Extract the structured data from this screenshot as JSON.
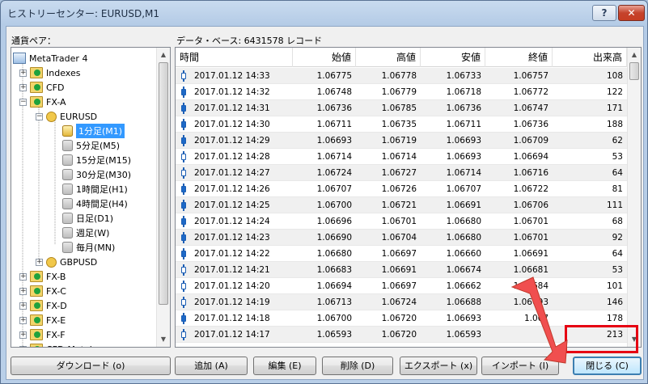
{
  "window": {
    "title": "ヒストリーセンター: EURUSD,M1"
  },
  "labels": {
    "pair": "通貨ペア：",
    "database": "データ・ベース: 6431578 レコード"
  },
  "tree": [
    {
      "label": "MetaTrader 4",
      "icon": "terminal-icon",
      "level": 0,
      "expander": ""
    },
    {
      "label": "Indexes",
      "icon": "folder-icon",
      "level": 1,
      "expander": "+"
    },
    {
      "label": "CFD",
      "icon": "folder-icon",
      "level": 1,
      "expander": "+"
    },
    {
      "label": "FX-A",
      "icon": "folder-icon",
      "level": 1,
      "expander": "−"
    },
    {
      "label": "EURUSD",
      "icon": "symbol-icon",
      "level": 2,
      "expander": "−"
    },
    {
      "label": "1分足(M1)",
      "icon": "database-active-icon",
      "level": 3,
      "expander": "",
      "selected": true
    },
    {
      "label": "5分足(M5)",
      "icon": "database-icon",
      "level": 3,
      "expander": ""
    },
    {
      "label": "15分足(M15)",
      "icon": "database-icon",
      "level": 3,
      "expander": ""
    },
    {
      "label": "30分足(M30)",
      "icon": "database-icon",
      "level": 3,
      "expander": ""
    },
    {
      "label": "1時間足(H1)",
      "icon": "database-icon",
      "level": 3,
      "expander": ""
    },
    {
      "label": "4時間足(H4)",
      "icon": "database-icon",
      "level": 3,
      "expander": ""
    },
    {
      "label": "日足(D1)",
      "icon": "database-icon",
      "level": 3,
      "expander": ""
    },
    {
      "label": "週足(W)",
      "icon": "database-icon",
      "level": 3,
      "expander": ""
    },
    {
      "label": "毎月(MN)",
      "icon": "database-icon",
      "level": 3,
      "expander": ""
    },
    {
      "label": "GBPUSD",
      "icon": "symbol-icon",
      "level": 2,
      "expander": "+"
    },
    {
      "label": "FX-B",
      "icon": "folder-icon",
      "level": 1,
      "expander": "+"
    },
    {
      "label": "FX-C",
      "icon": "folder-icon",
      "level": 1,
      "expander": "+"
    },
    {
      "label": "FX-D",
      "icon": "folder-icon",
      "level": 1,
      "expander": "+"
    },
    {
      "label": "FX-E",
      "icon": "folder-icon",
      "level": 1,
      "expander": "+"
    },
    {
      "label": "FX-F",
      "icon": "folder-icon",
      "level": 1,
      "expander": "+"
    },
    {
      "label": "CFD-Metals",
      "icon": "folder-icon",
      "level": 1,
      "expander": "+"
    }
  ],
  "table": {
    "columns": [
      "時間",
      "始値",
      "高値",
      "安値",
      "終値",
      "出来高"
    ],
    "rows": [
      [
        "2017.01.12 14:33",
        "1.06775",
        "1.06778",
        "1.06733",
        "1.06757",
        "108"
      ],
      [
        "2017.01.12 14:32",
        "1.06748",
        "1.06779",
        "1.06718",
        "1.06772",
        "122"
      ],
      [
        "2017.01.12 14:31",
        "1.06736",
        "1.06785",
        "1.06736",
        "1.06747",
        "171"
      ],
      [
        "2017.01.12 14:30",
        "1.06711",
        "1.06735",
        "1.06711",
        "1.06736",
        "188"
      ],
      [
        "2017.01.12 14:29",
        "1.06693",
        "1.06719",
        "1.06693",
        "1.06709",
        "62"
      ],
      [
        "2017.01.12 14:28",
        "1.06714",
        "1.06714",
        "1.06693",
        "1.06694",
        "53"
      ],
      [
        "2017.01.12 14:27",
        "1.06724",
        "1.06727",
        "1.06714",
        "1.06716",
        "64"
      ],
      [
        "2017.01.12 14:26",
        "1.06707",
        "1.06726",
        "1.06707",
        "1.06722",
        "81"
      ],
      [
        "2017.01.12 14:25",
        "1.06700",
        "1.06721",
        "1.06691",
        "1.06706",
        "111"
      ],
      [
        "2017.01.12 14:24",
        "1.06696",
        "1.06701",
        "1.06680",
        "1.06701",
        "68"
      ],
      [
        "2017.01.12 14:23",
        "1.06690",
        "1.06704",
        "1.06680",
        "1.06701",
        "92"
      ],
      [
        "2017.01.12 14:22",
        "1.06680",
        "1.06697",
        "1.06660",
        "1.06691",
        "64"
      ],
      [
        "2017.01.12 14:21",
        "1.06683",
        "1.06691",
        "1.06674",
        "1.06681",
        "53"
      ],
      [
        "2017.01.12 14:20",
        "1.06694",
        "1.06697",
        "1.06662",
        "1.06684",
        "101"
      ],
      [
        "2017.01.12 14:19",
        "1.06713",
        "1.06724",
        "1.06688",
        "1.06693",
        "146"
      ],
      [
        "2017.01.12 14:18",
        "1.06700",
        "1.06720",
        "1.06693",
        "1.067",
        "178"
      ],
      [
        "2017.01.12 14:17",
        "1.06593",
        "1.06720",
        "1.06593",
        "",
        "213"
      ]
    ]
  },
  "buttons": {
    "download": "ダウンロード (o)",
    "add": "追加 (A)",
    "edit": "編集 (E)",
    "delete": "削除 (D)",
    "export": "エクスポート (x)",
    "import": "インポート (I)",
    "close": "閉じる (C)"
  },
  "caption_buttons": {
    "help": "?",
    "close": "✕"
  },
  "colors": {
    "highlight": "#e60012",
    "selection": "#3399ff",
    "arrow": "#f04f4f"
  }
}
